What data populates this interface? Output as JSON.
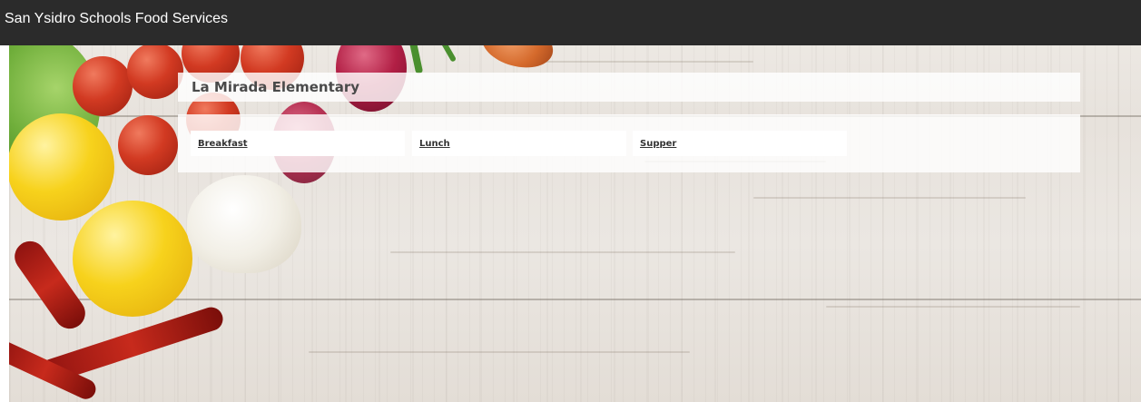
{
  "header": {
    "title": "San Ysidro Schools Food Services"
  },
  "school": {
    "name": "La Mirada Elementary"
  },
  "meals": [
    {
      "label": "Breakfast"
    },
    {
      "label": "Lunch"
    },
    {
      "label": "Supper"
    }
  ],
  "colors": {
    "topbar": "#2b2b2b",
    "panel": "#ffffff",
    "text": "#4a4a4a"
  }
}
